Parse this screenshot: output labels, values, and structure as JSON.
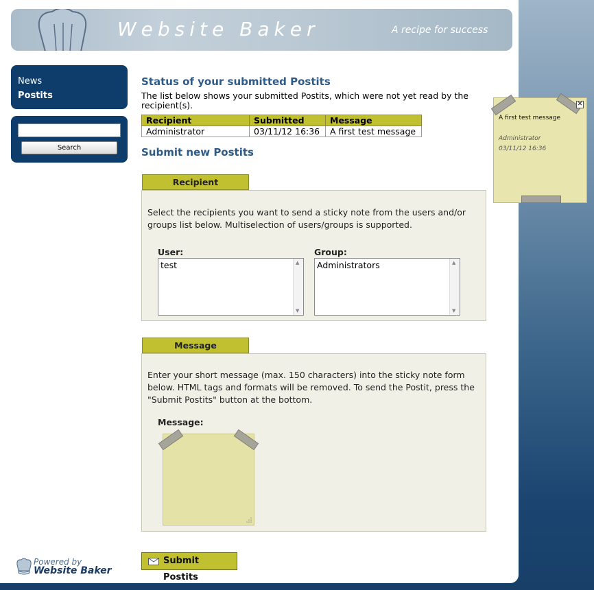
{
  "header": {
    "title": "Website Baker",
    "slogan": "A recipe for success"
  },
  "menu": {
    "items": [
      {
        "label": "News",
        "active": false
      },
      {
        "label": "Postits",
        "active": true
      }
    ]
  },
  "search": {
    "value": "",
    "button_label": "Search"
  },
  "powered": {
    "line1": "Powered by",
    "line2": "Website Baker"
  },
  "status": {
    "heading": "Status of your submitted Postits",
    "description": "The list below shows your submitted Postits, which were not yet read by the recipient(s).",
    "columns": [
      "Recipient",
      "Submitted",
      "Message"
    ],
    "rows": [
      [
        "Administrator",
        "03/11/12 16:36",
        "A first test message"
      ]
    ]
  },
  "submit_section": {
    "heading": "Submit new Postits",
    "recipient_tab": "Recipient",
    "recipient_text": "Select the recipients you want to send a sticky note from the users and/or groups list below. Multiselection of users/groups is supported.",
    "user_label": "User:",
    "user_options": [
      "test"
    ],
    "group_label": "Group:",
    "group_options": [
      "Administrators"
    ],
    "message_tab": "Message",
    "message_text": "Enter your short message (max. 150 characters) into the sticky note form below. HTML tags and formats will be removed. To send the Postit, press the \"Submit Postits\" button at the bottom.",
    "message_label": "Message:",
    "message_value": "",
    "submit_label": "Submit Postits"
  },
  "floating_postit": {
    "subject": "A first test message",
    "sender": "Administrator",
    "timestamp": "03/11/12 16:36"
  },
  "colors": {
    "accent": "#c0c030",
    "nav_bg": "#0e3c6b",
    "heading": "#2e5a87",
    "postit": "#e4e2a6"
  }
}
